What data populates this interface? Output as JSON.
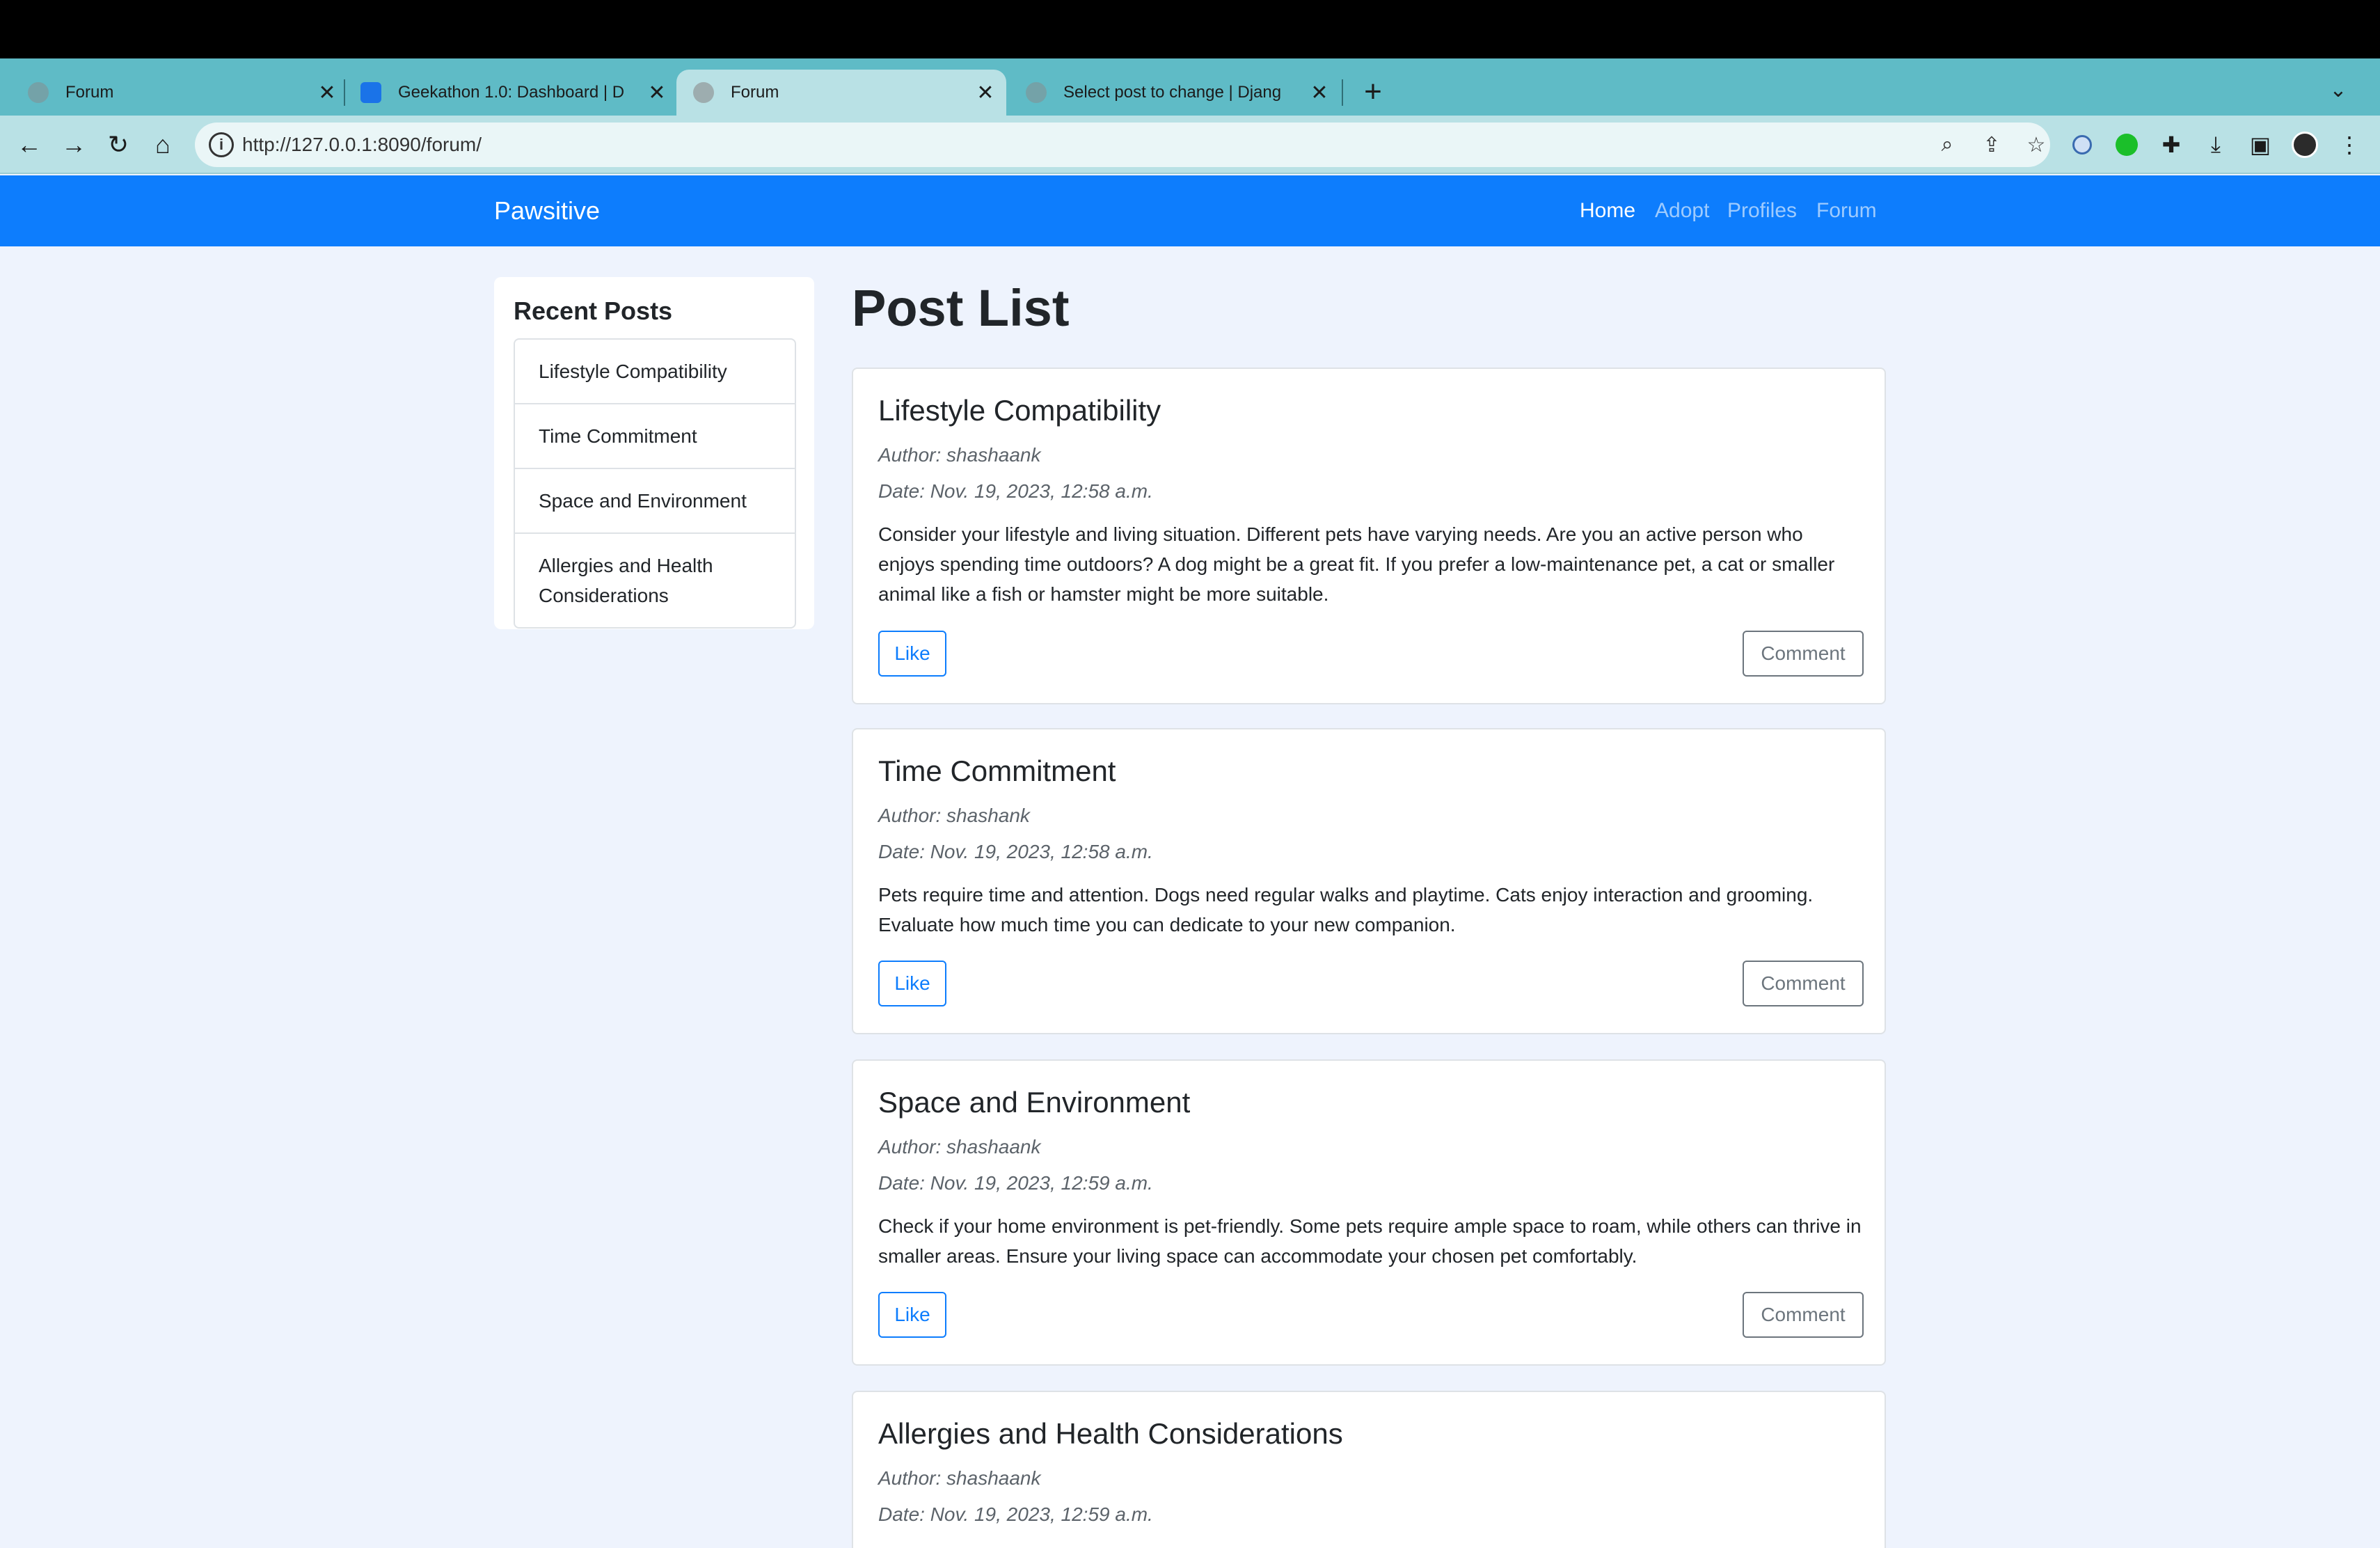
{
  "browser": {
    "tabs": [
      {
        "title": "Forum",
        "favicon_color": "#8a8a8a",
        "active": false
      },
      {
        "title": "Geekathon 1.0: Dashboard | D",
        "favicon_color": "#1a73e8",
        "active": false
      },
      {
        "title": "Forum",
        "favicon_color": "#8a8a8a",
        "active": true
      },
      {
        "title": "Select post to change | Djang",
        "favicon_color": "#8a8a8a",
        "active": false
      }
    ],
    "new_tab_label": "+",
    "url": "http://127.0.0.1:8090/forum/"
  },
  "navbar": {
    "brand": "Pawsitive",
    "links": [
      "Home",
      "Adopt",
      "Profiles",
      "Forum"
    ]
  },
  "sidebar": {
    "heading": "Recent Posts",
    "items": [
      "Lifestyle Compatibility",
      "Time Commitment",
      "Space and Environment",
      "Allergies and Health Considerations"
    ]
  },
  "main": {
    "title": "Post List",
    "posts": [
      {
        "title": "Lifestyle Compatibility",
        "author": "Author: shashaank",
        "date": "Date: Nov. 19, 2023, 12:58 a.m.",
        "content": "Consider your lifestyle and living situation. Different pets have varying needs. Are you an active person who enjoys spending time outdoors? A dog might be a great fit. If you prefer a low-maintenance pet, a cat or smaller animal like a fish or hamster might be more suitable.",
        "like_label": "Like",
        "comment_label": "Comment"
      },
      {
        "title": "Time Commitment",
        "author": "Author: shashank",
        "date": "Date: Nov. 19, 2023, 12:58 a.m.",
        "content": "Pets require time and attention. Dogs need regular walks and playtime. Cats enjoy interaction and grooming. Evaluate how much time you can dedicate to your new companion.",
        "like_label": "Like",
        "comment_label": "Comment"
      },
      {
        "title": "Space and Environment",
        "author": "Author: shashaank",
        "date": "Date: Nov. 19, 2023, 12:59 a.m.",
        "content": "Check if your home environment is pet-friendly. Some pets require ample space to roam, while others can thrive in smaller areas. Ensure your living space can accommodate your chosen pet comfortably.",
        "like_label": "Like",
        "comment_label": "Comment"
      },
      {
        "title": "Allergies and Health Considerations",
        "author": "Author: shashaank",
        "date": "Date: Nov. 19, 2023, 12:59 a.m."
      }
    ]
  }
}
